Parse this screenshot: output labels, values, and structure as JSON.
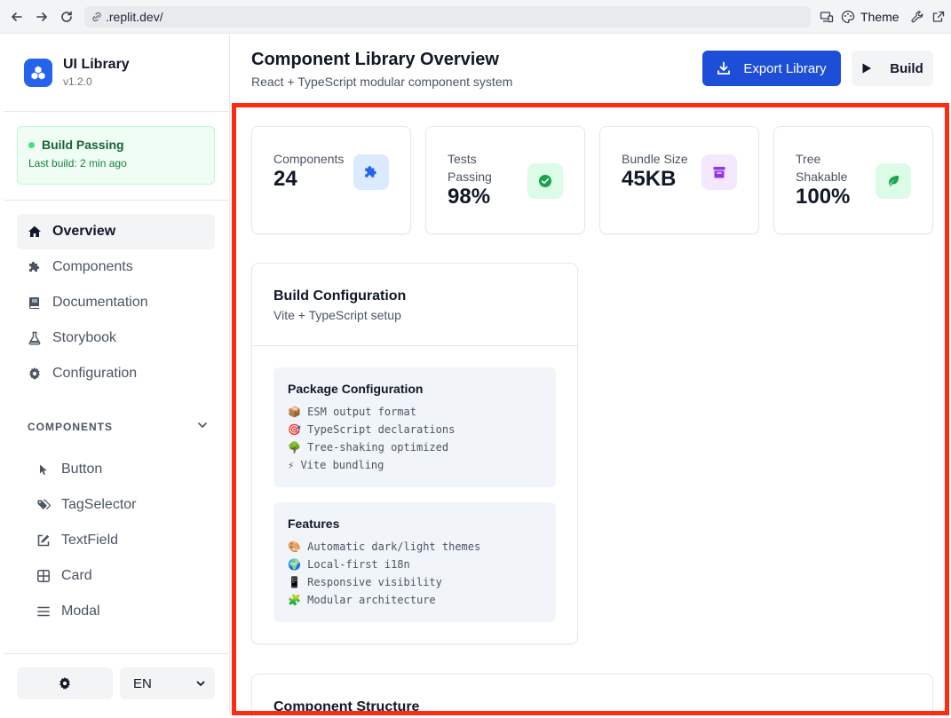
{
  "browser": {
    "url": ".replit.dev/",
    "theme_label": "Theme"
  },
  "sidebar": {
    "brand_name": "UI Library",
    "brand_version": "v1.2.0",
    "build_status_title": "Build Passing",
    "build_status_sub": "Last build: 2 min ago",
    "nav": [
      {
        "label": "Overview",
        "icon": "home-icon",
        "active": true
      },
      {
        "label": "Components",
        "icon": "puzzle-icon",
        "active": false
      },
      {
        "label": "Documentation",
        "icon": "book-icon",
        "active": false
      },
      {
        "label": "Storybook",
        "icon": "flask-icon",
        "active": false
      },
      {
        "label": "Configuration",
        "icon": "gear-icon",
        "active": false
      }
    ],
    "components_header": "COMPONENTS",
    "components": [
      {
        "label": "Button",
        "icon": "pointer-icon"
      },
      {
        "label": "TagSelector",
        "icon": "tags-icon"
      },
      {
        "label": "TextField",
        "icon": "edit-icon"
      },
      {
        "label": "Card",
        "icon": "grid-icon"
      },
      {
        "label": "Modal",
        "icon": "menu-icon"
      }
    ],
    "language": "EN"
  },
  "header": {
    "title": "Component Library Overview",
    "subtitle": "React + TypeScript modular component system",
    "export_label": "Export Library",
    "build_label": "Build"
  },
  "stats": [
    {
      "label": "Components",
      "value": "24",
      "icon": "puzzle-icon",
      "color": "#2563eb",
      "bg": "#dbeafe"
    },
    {
      "label": "Tests Passing",
      "value": "98%",
      "icon": "check-circle-icon",
      "color": "#16a34a",
      "bg": "#dcfce7"
    },
    {
      "label": "Bundle Size",
      "value": "45KB",
      "icon": "archive-icon",
      "color": "#9333ea",
      "bg": "#f3e8ff"
    },
    {
      "label": "Tree Shakable",
      "value": "100%",
      "icon": "leaf-icon",
      "color": "#16a34a",
      "bg": "#dcfce7"
    }
  ],
  "build_config": {
    "title": "Build Configuration",
    "subtitle": "Vite + TypeScript setup",
    "package": {
      "title": "Package Configuration",
      "lines": [
        "📦 ESM output format",
        "🎯 TypeScript declarations",
        "🌳 Tree-shaking optimized",
        "⚡ Vite bundling"
      ]
    },
    "features": {
      "title": "Features",
      "lines": [
        "🎨 Automatic dark/light themes",
        "🌍 Local-first i18n",
        "📱 Responsive visibility",
        "🧩 Modular architecture"
      ]
    }
  },
  "structure": {
    "title": "Component Structure"
  },
  "colors": {
    "accent": "#1d4ed8",
    "highlight": "#ff2a12",
    "success": "#4ade80"
  }
}
